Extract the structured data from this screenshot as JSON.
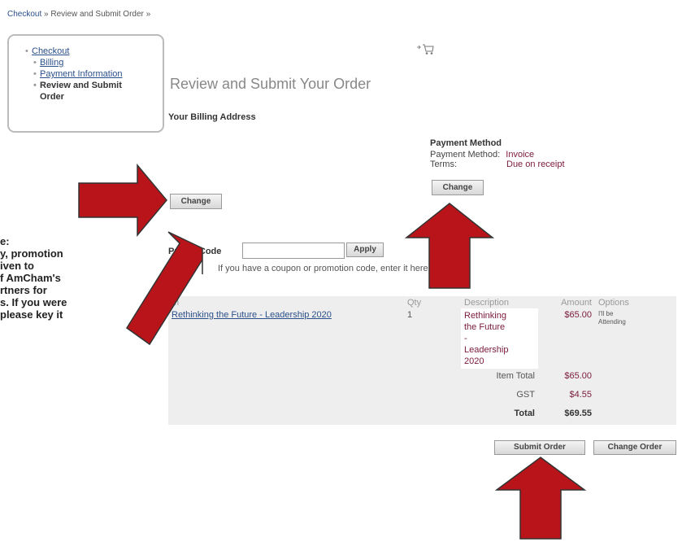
{
  "breadcrumb": {
    "checkout": "Checkout",
    "sep1": " » ",
    "current": "Review and Submit Order",
    "sep2": " »"
  },
  "nav": {
    "checkout": "Checkout",
    "billing": "Billing",
    "payment": "Payment Information",
    "review": "Review and Submit Order"
  },
  "page": {
    "title": "Review and Submit Your Order",
    "cart_icon": "cart-icon"
  },
  "billing": {
    "heading": "Your Billing Address",
    "change_label": "Change"
  },
  "payment": {
    "heading": "Payment Method",
    "method_label": "Payment Method:",
    "method_value": "Invoice",
    "terms_label": "Terms:",
    "terms_value": "Due on receipt",
    "change_label": "Change"
  },
  "promo": {
    "label": "Promo Code",
    "value": "",
    "apply_label": "Apply",
    "hint": "If you have a coupon or promotion code, enter it here"
  },
  "annotation": {
    "lines": [
      "e:",
      "y, promotion",
      "iven to",
      "f AmCham's",
      "rtners for",
      "s. If you were",
      "please key it"
    ]
  },
  "table": {
    "headers": {
      "item": "m",
      "qty": "Qty",
      "description": "Description",
      "amount": "Amount",
      "options": "Options"
    },
    "row": {
      "item": "Rethinking the Future - Leadership 2020",
      "qty": "1",
      "description_lines": [
        "Rethinking",
        "the Future",
        "-",
        "Leadership",
        "2020"
      ],
      "amount": "$65.00",
      "option_lines": [
        "I'll be",
        "Attending"
      ]
    },
    "item_total_label": "Item Total",
    "item_total": "$65.00",
    "gst_label": "GST",
    "gst": "$4.55",
    "total_label": "Total",
    "total": "$69.55"
  },
  "actions": {
    "submit_label": "Submit Order",
    "change_order_label": "Change Order"
  },
  "colors": {
    "arrow": "#b8141a",
    "link": "#2a4f8a",
    "accent": "#7a1a3a"
  }
}
